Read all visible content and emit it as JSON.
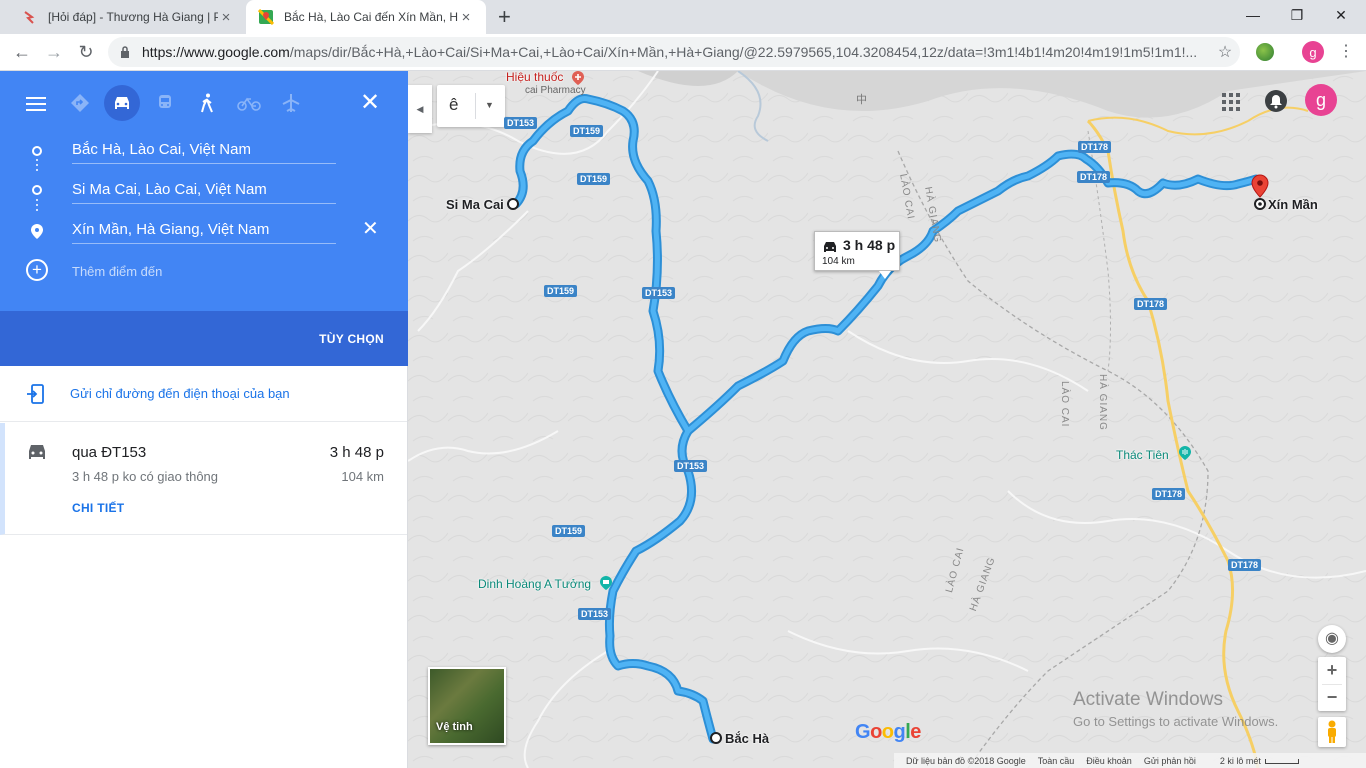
{
  "browser": {
    "tabs": [
      {
        "title": "[Hỏi đáp] - Thương Hà Giang | Pl",
        "active": false
      },
      {
        "title": "Bắc Hà, Lào Cai đến Xín Mần, Hà",
        "active": true
      }
    ],
    "new_tab": "+",
    "url_host": "https://www.google.com",
    "url_rest": "/maps/dir/Bắc+Hà,+Lào+Cai/Si+Ma+Cai,+Lào+Cai/Xín+Mần,+Hà+Giang/@22.5979565,104.3208454,12z/data=!3m1!4b1!4m20!4m19!1m5!1m1!...",
    "profile_initial": "g",
    "window_controls": {
      "minimize": "—",
      "maximize": "❐",
      "close": "✕"
    }
  },
  "directions": {
    "waypoints": [
      "Bắc Hà, Lào Cai, Việt Nam",
      "Si Ma Cai, Lào Cai, Việt Nam",
      "Xín Mần, Hà Giang, Việt Nam"
    ],
    "add_destination": "Thêm điểm đến",
    "options": "TÙY CHỌN",
    "send_to_phone": "Gửi chỉ đường đến điện thoại của bạn",
    "route": {
      "via": "qua ĐT153",
      "time": "3 h 48 p",
      "traffic": "3 h 48 p ko có giao thông",
      "distance": "104 km",
      "details": "CHI TIẾT"
    }
  },
  "map": {
    "layer_button": "ê",
    "profile_initial": "g",
    "callout": {
      "time": "3 h 48 p",
      "distance": "104 km"
    },
    "places": {
      "si_ma_cai": "Si Ma Cai",
      "bac_ha": "Bắc Hà",
      "xin_man": "Xín Mần"
    },
    "pois": {
      "pharmacy": "Hiệu thuốc",
      "pharmacy_sub": "cai Pharmacy",
      "dinh": "Dinh Hoàng A Tưởng",
      "thac_tien": "Thác Tiên"
    },
    "regions": {
      "ha_giang_1": "HÀ GIANG",
      "lao_cai_1": "LÀO CAI",
      "lao_cai_2": "LÀO CAI",
      "ha_giang_2": "HÀ GIANG",
      "lao_cai_3": "LÀO CAI",
      "ha_giang_3": "HÀ GIANG"
    },
    "china_label": "中",
    "shields": {
      "dt153_a": "DT153",
      "dt159_a": "DT159",
      "dt159_b": "DT159",
      "dt159_c": "DT159",
      "dt153_b": "DT153",
      "dt153_c": "DT153",
      "dt159_d": "DT159",
      "dt153_d": "DT153",
      "dt178_a": "DT178",
      "dt178_b": "DT178",
      "dt178_c": "DT178",
      "dt178_d": "DT178",
      "dt178_e": "DT178"
    },
    "satellite": "Vệ tinh",
    "zoom_in": "+",
    "zoom_out": "−",
    "google": "Google",
    "activate_title": "Activate Windows",
    "activate_sub": "Go to Settings to activate Windows.",
    "footer": {
      "map_data": "Dữ liệu bản đồ ©2018 Google",
      "global": "Toàn cầu",
      "terms": "Điều khoản",
      "feedback": "Gửi phản hồi",
      "scale": "2 ki lô mét"
    }
  },
  "colors": {
    "route": "#4fb3f4",
    "route_outline": "#2d8fd6",
    "panel_blue": "#4285f4",
    "panel_dark": "#3367d6",
    "pin_red": "#ea4335",
    "yellow_road": "#f6cf65"
  }
}
